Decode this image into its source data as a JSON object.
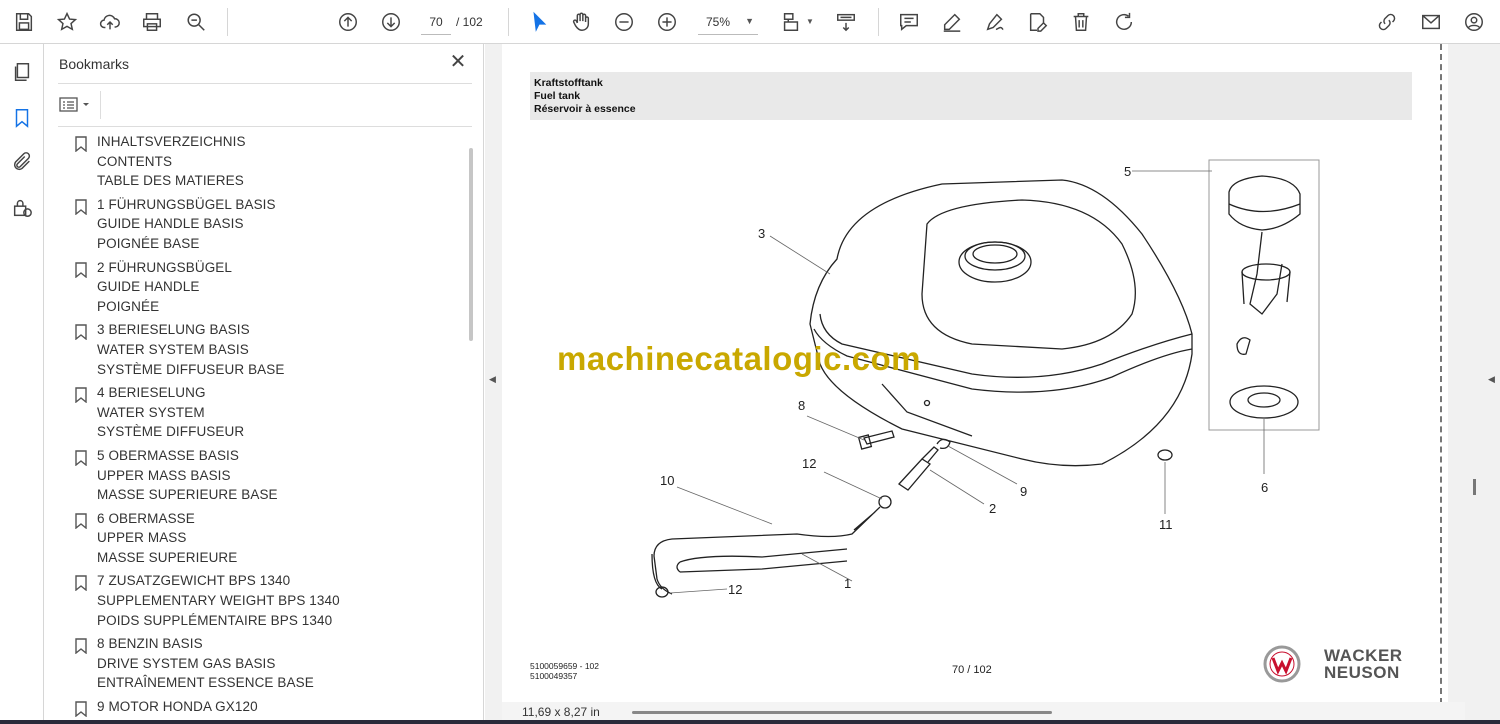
{
  "toolbar": {
    "page_current": "70",
    "page_total": "/  102",
    "zoom": "75%",
    "icons": [
      "save-icon",
      "star-icon",
      "cloud-upload-icon",
      "print-icon",
      "zoom-search-icon",
      "page-up-icon",
      "page-down-icon",
      "select-cursor-icon",
      "hand-icon",
      "zoom-out-icon",
      "zoom-in-icon",
      "page-fit-icon",
      "scroll-mode-icon",
      "comment-icon",
      "pen-icon",
      "sign-icon",
      "edit-text-icon",
      "delete-icon",
      "rotate-icon",
      "share-link-icon",
      "mail-icon",
      "account-icon"
    ]
  },
  "sidebar": {
    "icons": [
      "pages-icon",
      "bookmark-icon",
      "attachment-icon",
      "security-icon"
    ]
  },
  "bookmarks": {
    "title": "Bookmarks",
    "items": [
      {
        "lines": [
          "INHALTSVERZEICHNIS",
          "CONTENTS",
          "TABLE DES MATIERES"
        ]
      },
      {
        "lines": [
          "1 FÜHRUNGSBÜGEL BASIS",
          "GUIDE HANDLE BASIS",
          "POIGNÉE BASE"
        ]
      },
      {
        "lines": [
          "2 FÜHRUNGSBÜGEL",
          "GUIDE HANDLE",
          "POIGNÉE"
        ]
      },
      {
        "lines": [
          "3 BERIESELUNG BASIS",
          "WATER SYSTEM BASIS",
          "SYSTÈME DIFFUSEUR BASE"
        ]
      },
      {
        "lines": [
          "4 BERIESELUNG",
          "WATER SYSTEM",
          "SYSTÈME DIFFUSEUR"
        ]
      },
      {
        "lines": [
          "5 OBERMASSE BASIS",
          "UPPER MASS BASIS",
          "MASSE SUPERIEURE BASE"
        ]
      },
      {
        "lines": [
          "6 OBERMASSE",
          "UPPER MASS",
          "MASSE SUPERIEURE"
        ]
      },
      {
        "lines": [
          "7 ZUSATZGEWICHT BPS 1340",
          "SUPPLEMENTARY WEIGHT  BPS 1340",
          "POIDS SUPPLÉMENTAIRE  BPS 1340"
        ]
      },
      {
        "lines": [
          "8 BENZIN BASIS",
          "DRIVE SYSTEM GAS BASIS",
          "ENTRAÎNEMENT ESSENCE BASE"
        ]
      },
      {
        "lines": [
          "9 MOTOR HONDA GX120"
        ]
      }
    ]
  },
  "document": {
    "header_de": "Kraftstofftank",
    "header_en": "Fuel tank",
    "header_fr": "Réservoir à essence",
    "callouts": [
      "1",
      "2",
      "3",
      "5",
      "6",
      "8",
      "9",
      "10",
      "11",
      "12",
      "12"
    ],
    "watermark": "machinecatalogic.com",
    "footer_code_1": "5100059659 - 102",
    "footer_code_2": "5100049357",
    "footer_page": "70 / 102",
    "brand_line1": "WACKER",
    "brand_line2": "NEUSON"
  },
  "status": {
    "page_size": "11,69 x 8,27 in"
  }
}
